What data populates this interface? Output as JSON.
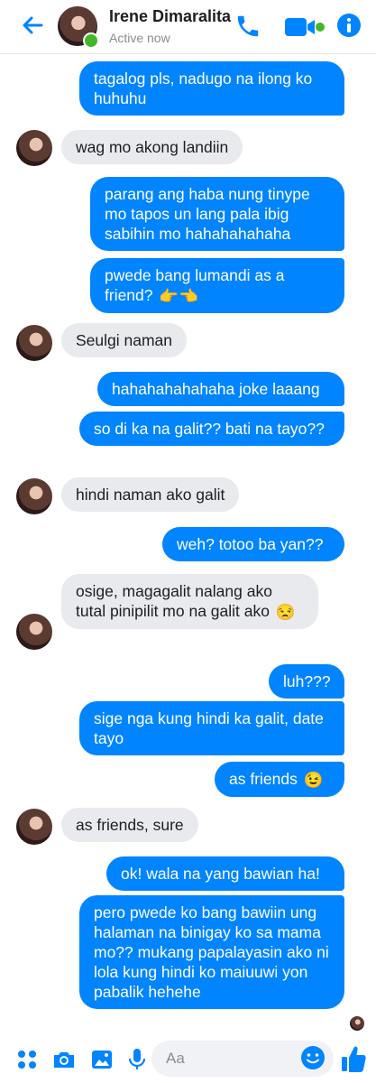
{
  "header": {
    "name": "Irene Dimaralita",
    "status": "Active now"
  },
  "messages": [
    {
      "side": "out",
      "text": "tagalog pls, nadugo na ilong ko huhuhu"
    },
    {
      "side": "in",
      "text": "wag mo akong landiin"
    },
    {
      "side": "out",
      "text": "parang ang haba nung tinype mo tapos un lang pala ibig sabihin mo hahahahahaha"
    },
    {
      "side": "out",
      "text": "pwede bang lumandi as a friend?",
      "emoji": "👉👈"
    },
    {
      "side": "in",
      "text": "Seulgi naman"
    },
    {
      "side": "out",
      "text": "hahahahahahaha joke laaang"
    },
    {
      "side": "out",
      "text": "so di ka na galit?? bati na tayo??"
    },
    {
      "side": "in",
      "text": "hindi naman ako galit"
    },
    {
      "side": "out",
      "text": "weh? totoo ba yan??"
    },
    {
      "side": "in",
      "text": "osige, magagalit nalang ako tutal pinipilit mo na galit ako",
      "emoji": "😒"
    },
    {
      "side": "out",
      "text": "luh???"
    },
    {
      "side": "out",
      "text": "sige nga kung hindi ka galit, date tayo"
    },
    {
      "side": "out",
      "text": "as friends",
      "emoji": "😉"
    },
    {
      "side": "in",
      "text": "as friends, sure"
    },
    {
      "side": "out",
      "text": "ok! wala na yang bawian ha!"
    },
    {
      "side": "out",
      "text": "pero pwede ko bang bawiin ung halaman na binigay ko sa mama mo?? mukang papalayasin ako ni lola kung hindi ko maiuuwi yon pabalik hehehe"
    }
  ],
  "composer": {
    "placeholder": "Aa"
  },
  "colors": {
    "accent": "#0084ff",
    "incoming_bubble": "#e9eaed",
    "online": "#42b72a"
  },
  "icons": [
    "back-arrow-icon",
    "phone-icon",
    "video-camera-icon",
    "info-icon",
    "apps-grid-icon",
    "camera-icon",
    "image-icon",
    "microphone-icon",
    "smiley-icon",
    "thumbs-up-icon"
  ]
}
